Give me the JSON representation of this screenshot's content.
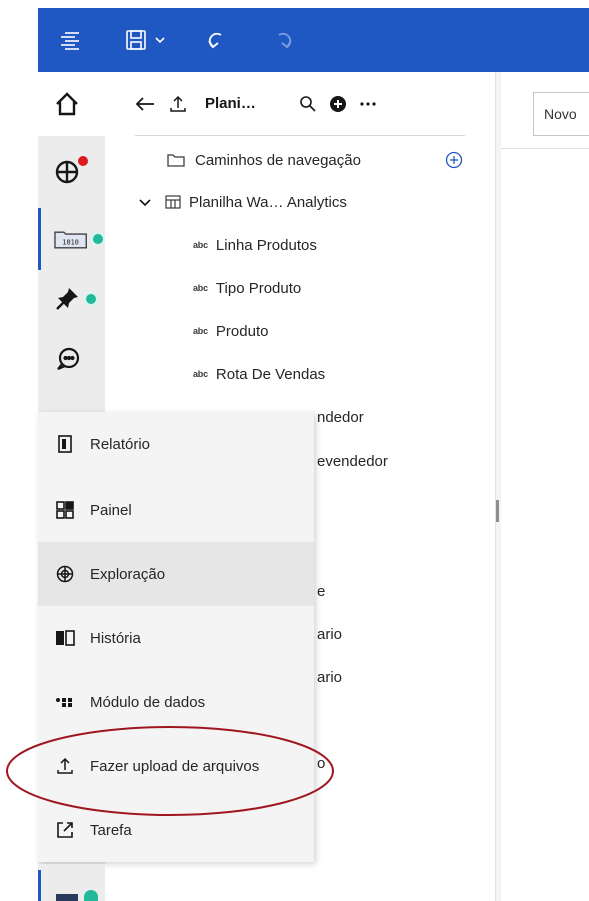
{
  "toolbar": {
    "icons": [
      "menu-icon",
      "save-icon",
      "chevron-down-icon",
      "undo-icon",
      "redo-icon"
    ]
  },
  "rail": {
    "items": [
      "home-icon",
      "exploration-icon",
      "data-module-icon",
      "pin-icon",
      "chat-icon"
    ]
  },
  "panel": {
    "title": "Plani…"
  },
  "tree": {
    "nav_paths": "Caminhos de navegação",
    "sheet": "Planilha Wa… Analytics",
    "columns": [
      "Linha Produtos",
      "Tipo Produto",
      "Produto",
      "Rota De Vendas"
    ],
    "abc": "abc",
    "partial": [
      "ndedor",
      "evendedor",
      "e",
      "ario",
      "ario",
      "o"
    ]
  },
  "canvas": {
    "tab_label": "Novo"
  },
  "menu": {
    "items": [
      {
        "label": "Relatório",
        "icon": "report-icon"
      },
      {
        "label": "Painel",
        "icon": "dashboard-icon"
      },
      {
        "label": "Exploração",
        "icon": "exploration-icon"
      },
      {
        "label": "História",
        "icon": "story-icon"
      },
      {
        "label": "Módulo de dados",
        "icon": "data-module-icon"
      },
      {
        "label": "Fazer upload de arquivos",
        "icon": "upload-icon"
      },
      {
        "label": "Tarefa",
        "icon": "job-icon"
      }
    ]
  },
  "colors": {
    "topbar": "#1f57c3",
    "status_dot": "#22b99a",
    "notification": "#e0191f",
    "annotation": "#a01620"
  }
}
